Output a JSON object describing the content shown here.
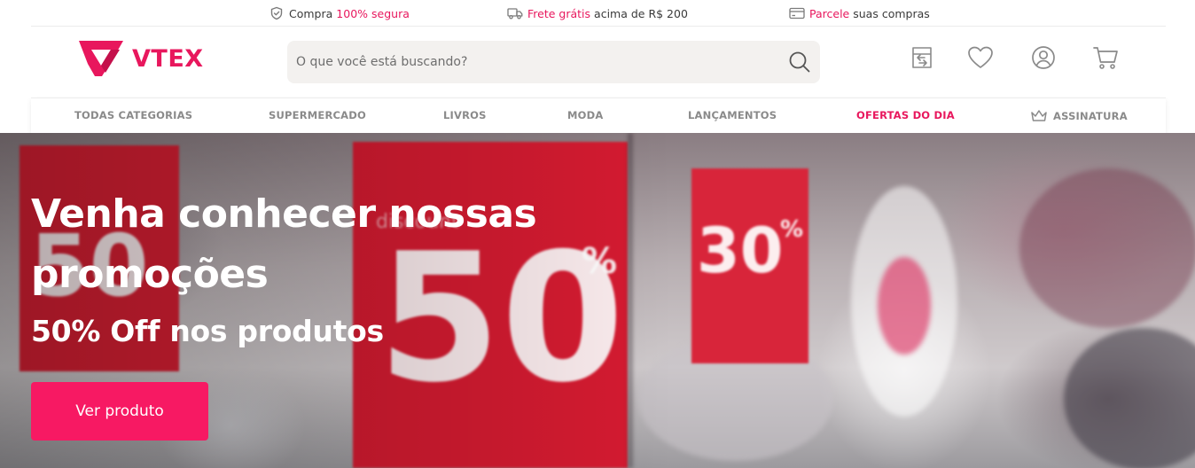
{
  "colors": {
    "brand": "#e8175d",
    "button": "#f71963",
    "nav_text": "#8a8a8a"
  },
  "topbar": {
    "items": [
      {
        "icon": "shield-check-icon",
        "before": "Compra",
        "highlight": "100% segura",
        "after": ""
      },
      {
        "icon": "truck-icon",
        "before": "",
        "highlight": "Frete grátis",
        "after": "acima de R$ 200"
      },
      {
        "icon": "credit-card-icon",
        "before": "",
        "highlight": "Parcele",
        "after": "suas compras"
      }
    ]
  },
  "header": {
    "logo_text": "VTEX",
    "search_placeholder": "O que você está buscando?",
    "icons": [
      "store-icon",
      "heart-icon",
      "user-icon",
      "cart-icon"
    ]
  },
  "nav": {
    "items": [
      {
        "label": "TODAS CATEGORIAS"
      },
      {
        "label": "SUPERMERCADO"
      },
      {
        "label": "LIVROS"
      },
      {
        "label": "MODA"
      },
      {
        "label": "LANÇAMENTOS"
      },
      {
        "label": "OFERTAS DO DIA"
      },
      {
        "label": "ASSINATURA",
        "icon": "crown-icon"
      }
    ]
  },
  "hero": {
    "title": "Venha conhecer nossas promoções",
    "subtitle": "50% Off nos produtos",
    "button_label": "Ver produto",
    "sign_texts": [
      "50",
      "50",
      "%",
      "30",
      "%",
      "discount"
    ]
  }
}
